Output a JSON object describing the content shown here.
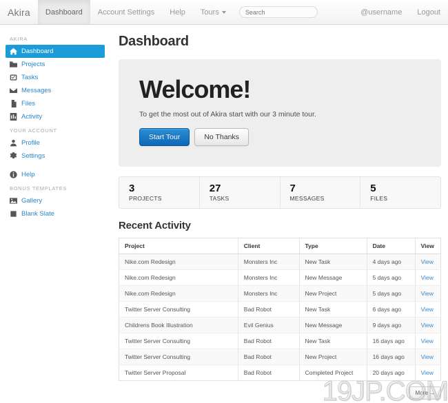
{
  "navbar": {
    "brand": "Akira",
    "items": [
      {
        "label": "Dashboard",
        "active": true,
        "caret": false
      },
      {
        "label": "Account Settings",
        "active": false,
        "caret": false
      },
      {
        "label": "Help",
        "active": false,
        "caret": false
      },
      {
        "label": "Tours",
        "active": false,
        "caret": true
      }
    ],
    "search": {
      "placeholder": "Search",
      "value": ""
    },
    "right": [
      {
        "label": "@username"
      },
      {
        "label": "Logout"
      }
    ]
  },
  "sidebar": {
    "groups": [
      {
        "heading": "AKIRA",
        "items": [
          {
            "label": "Dashboard",
            "icon": "home-icon",
            "active": true
          },
          {
            "label": "Projects",
            "icon": "folder-icon",
            "active": false
          },
          {
            "label": "Tasks",
            "icon": "check-task-icon",
            "active": false
          },
          {
            "label": "Messages",
            "icon": "envelope-icon",
            "active": false
          },
          {
            "label": "Files",
            "icon": "file-icon",
            "active": false
          },
          {
            "label": "Activity",
            "icon": "bar-chart-icon",
            "active": false
          }
        ]
      },
      {
        "heading": "YOUR ACCOUNT",
        "items": [
          {
            "label": "Profile",
            "icon": "user-icon",
            "active": false
          },
          {
            "label": "Settings",
            "icon": "gear-icon",
            "active": false
          }
        ]
      },
      {
        "heading": "",
        "items": [
          {
            "label": "Help",
            "icon": "info-circle-icon",
            "active": false
          }
        ]
      },
      {
        "heading": "BONUS TEMPLATES",
        "items": [
          {
            "label": "Gallery",
            "icon": "picture-icon",
            "active": false
          },
          {
            "label": "Blank Slate",
            "icon": "square-icon",
            "active": false
          }
        ]
      }
    ]
  },
  "main": {
    "page_title": "Dashboard",
    "hero": {
      "headline": "Welcome!",
      "subtext": "To get the most out of Akira start with our 3 minute tour.",
      "primary_button": "Start Tour",
      "secondary_button": "No Thanks"
    },
    "stats": [
      {
        "number": "3",
        "label": "PROJECTS"
      },
      {
        "number": "27",
        "label": "TASKS"
      },
      {
        "number": "7",
        "label": "MESSAGES"
      },
      {
        "number": "5",
        "label": "FILES"
      }
    ],
    "activity": {
      "title": "Recent Activity",
      "columns": [
        "Project",
        "Client",
        "Type",
        "Date",
        "View"
      ],
      "rows": [
        {
          "project": "Nike.com Redesign",
          "client": "Monsters Inc",
          "type": "New Task",
          "date": "4 days ago",
          "view": "View"
        },
        {
          "project": "Nike.com Redesign",
          "client": "Monsters Inc",
          "type": "New Message",
          "date": "5 days ago",
          "view": "View"
        },
        {
          "project": "Nike.com Redesign",
          "client": "Monsters Inc",
          "type": "New Project",
          "date": "5 days ago",
          "view": "View"
        },
        {
          "project": "Twitter Server Consulting",
          "client": "Bad Robot",
          "type": "New Task",
          "date": "6 days ago",
          "view": "View"
        },
        {
          "project": "Childrens Book Illustration",
          "client": "Evil Genius",
          "type": "New Message",
          "date": "9 days ago",
          "view": "View"
        },
        {
          "project": "Twitter Server Consulting",
          "client": "Bad Robot",
          "type": "New Task",
          "date": "16 days ago",
          "view": "View"
        },
        {
          "project": "Twitter Server Consulting",
          "client": "Bad Robot",
          "type": "New Project",
          "date": "16 days ago",
          "view": "View"
        },
        {
          "project": "Twitter Server Proposal",
          "client": "Bad Robot",
          "type": "Completed Project",
          "date": "20 days ago",
          "view": "View"
        }
      ],
      "more_button": "More →"
    },
    "watermark": "19JP.COM"
  },
  "colors": {
    "accent_active": "#1b9bd8",
    "link": "#2a86ca",
    "primary_button": "#0f66b5",
    "hero_bg": "#eeeeee"
  }
}
